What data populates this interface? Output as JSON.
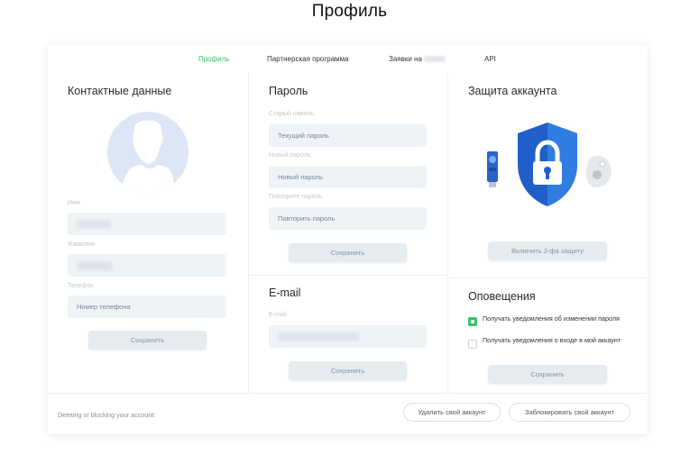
{
  "page": {
    "title": "Профиль"
  },
  "tabs": [
    {
      "label": "Профиль",
      "active": true
    },
    {
      "label": "Партнерская программа",
      "active": false
    },
    {
      "label": "Заявки на",
      "active": false
    },
    {
      "label": "API",
      "active": false
    }
  ],
  "contacts": {
    "title": "Контактные данные",
    "name_label": "Имя",
    "surname_label": "Фамилия",
    "phone_label": "Телефон",
    "phone_placeholder": "Номер телефона",
    "save_label": "Сохранить"
  },
  "password": {
    "title": "Пароль",
    "old_label": "Старый пароль",
    "old_placeholder": "Текущий пароль",
    "new_label": "Новый пароль",
    "new_placeholder": "Новый пароль",
    "repeat_label": "Повторите пароль",
    "repeat_placeholder": "Повторить пароль",
    "save_label": "Сохранить"
  },
  "email": {
    "title": "E-mail",
    "label": "E-mail",
    "save_label": "Сохранить"
  },
  "security": {
    "title": "Защита аккаунта",
    "enable_2fa_label": "Включить 2-фа защиту"
  },
  "notifications": {
    "title": "Оповещения",
    "items": [
      {
        "label": "Получать уведомления об изменении пароля",
        "checked": true
      },
      {
        "label": "Получать уведомления о входе в мой аккаунт",
        "checked": false
      }
    ],
    "save_label": "Сохранить"
  },
  "footer": {
    "text": "Deleting or blocking your account:",
    "delete_label": "Удалить свой аккаунт",
    "block_label": "Заблокировать свой аккаунт"
  },
  "colors": {
    "accent": "#3bbf6b",
    "shield": "#2f7de1",
    "input_bg": "#eef3f8",
    "button_bg": "#e6ebf0"
  }
}
